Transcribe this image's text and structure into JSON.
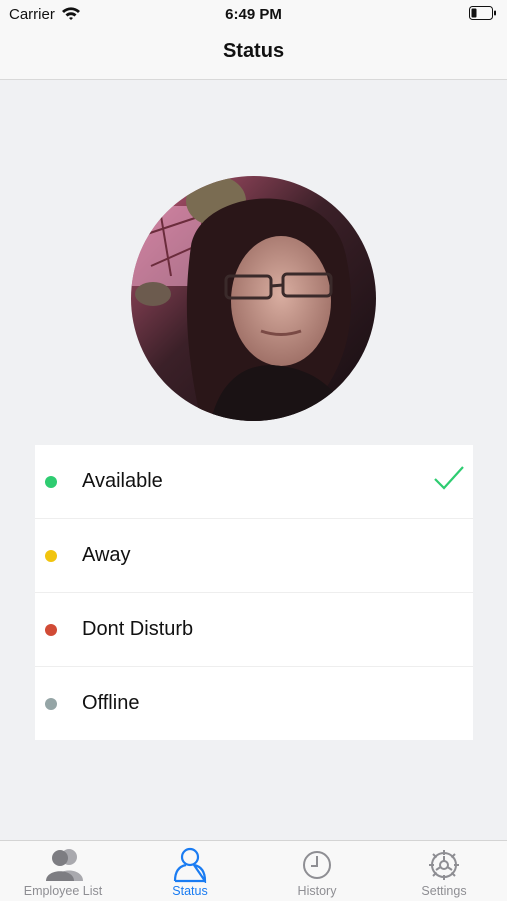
{
  "status_bar": {
    "carrier": "Carrier",
    "time": "6:49 PM"
  },
  "nav": {
    "title": "Status"
  },
  "statuses": [
    {
      "label": "Available",
      "color": "#2ecc71",
      "selected": true
    },
    {
      "label": "Away",
      "color": "#f1c40f",
      "selected": false
    },
    {
      "label": "Dont Disturb",
      "color": "#d14b36",
      "selected": false
    },
    {
      "label": "Offline",
      "color": "#95a5a6",
      "selected": false
    }
  ],
  "tabs": [
    {
      "label": "Employee List",
      "icon": "people-icon",
      "active": false
    },
    {
      "label": "Status",
      "icon": "person-outline-icon",
      "active": true
    },
    {
      "label": "History",
      "icon": "clock-icon",
      "active": false
    },
    {
      "label": "Settings",
      "icon": "gear-icon",
      "active": false
    }
  ],
  "colors": {
    "accent": "#1a7cf2",
    "check": "#2ecc71",
    "inactive_tab": "#8e8e93"
  }
}
